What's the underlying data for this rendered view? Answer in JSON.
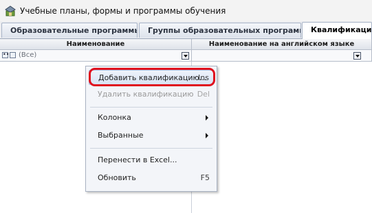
{
  "window": {
    "title": "Учебные планы, формы и программы обучения",
    "icon": "graduation-cap-icon"
  },
  "tabs": [
    {
      "label": "Образовательные программы"
    },
    {
      "label": "Группы образовательных программ"
    },
    {
      "label": "Квалификации сп"
    }
  ],
  "grid": {
    "columns": [
      {
        "header": "Наименование",
        "filter_value": "(Все)"
      },
      {
        "header": "Наименование на английском языке"
      }
    ]
  },
  "context_menu": {
    "items": [
      {
        "label": "Добавить квалификацию...",
        "shortcut": "Ins"
      },
      {
        "label": "Удалить квалификацию",
        "shortcut": "Del"
      },
      {
        "label": "Колонка"
      },
      {
        "label": "Выбранные"
      },
      {
        "label": "Перенести в Excel..."
      },
      {
        "label": "Обновить",
        "shortcut": "F5"
      }
    ]
  },
  "colors": {
    "highlight_border": "#e0101e"
  }
}
